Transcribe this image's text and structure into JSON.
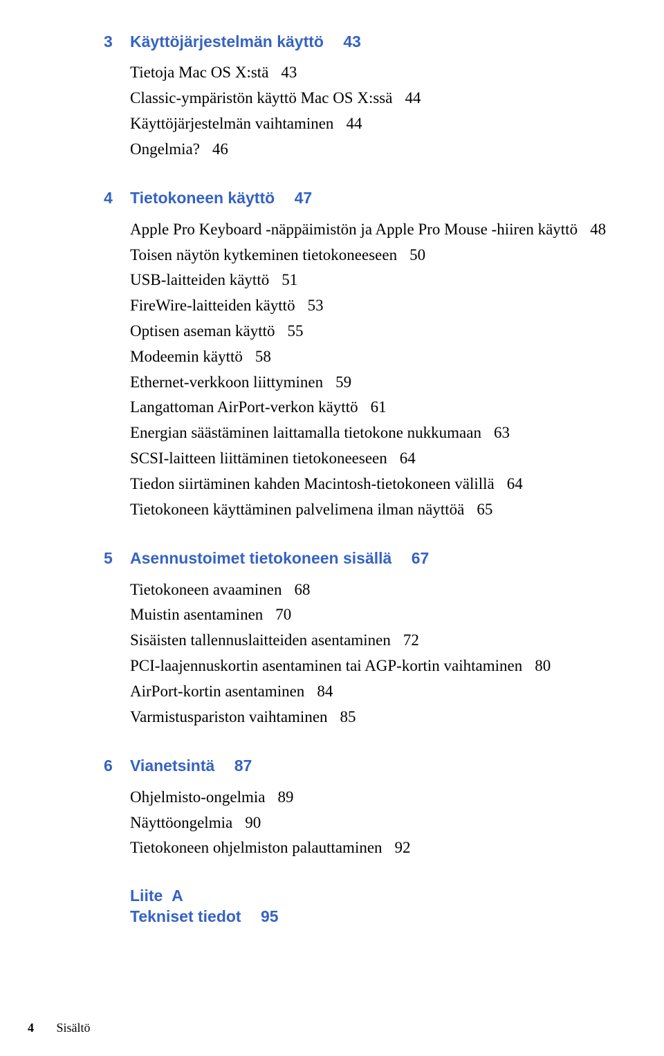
{
  "chapters": [
    {
      "num": "3",
      "title": "Käyttöjärjestelmän käyttö",
      "page": "43",
      "entries": [
        {
          "t": "Tietoja Mac OS X:stä",
          "p": "43"
        },
        {
          "t": "Classic-ympäristön käyttö Mac OS  X:ssä",
          "p": "44"
        },
        {
          "t": "Käyttöjärjestelmän vaihtaminen",
          "p": "44"
        },
        {
          "t": "Ongelmia?",
          "p": "46"
        }
      ]
    },
    {
      "num": "4",
      "title": "Tietokoneen käyttö",
      "page": "47",
      "entries": [
        {
          "t": "Apple Pro Keyboard -näppäimistön ja Apple Pro Mouse -hiiren käyttö",
          "p": "48"
        },
        {
          "t": "Toisen näytön kytkeminen tietokoneeseen",
          "p": "50"
        },
        {
          "t": "USB-laitteiden käyttö",
          "p": "51"
        },
        {
          "t": "FireWire-laitteiden käyttö",
          "p": "53"
        },
        {
          "t": "Optisen aseman käyttö",
          "p": "55"
        },
        {
          "t": "Modeemin käyttö",
          "p": "58"
        },
        {
          "t": "Ethernet-verkkoon liittyminen",
          "p": "59"
        },
        {
          "t": "Langattoman AirPort-verkon käyttö",
          "p": "61"
        },
        {
          "t": "Energian säästäminen laittamalla tietokone nukkumaan",
          "p": "63"
        },
        {
          "t": "SCSI-laitteen liittäminen tietokoneeseen",
          "p": "64"
        },
        {
          "t": "Tiedon siirtäminen kahden Macintosh-tietokoneen välillä",
          "p": "64"
        },
        {
          "t": "Tietokoneen käyttäminen palvelimena ilman näyttöä",
          "p": "65"
        }
      ]
    },
    {
      "num": "5",
      "title": "Asennustoimet tietokoneen sisällä",
      "page": "67",
      "entries": [
        {
          "t": "Tietokoneen avaaminen",
          "p": "68"
        },
        {
          "t": "Muistin asentaminen",
          "p": "70"
        },
        {
          "t": "Sisäisten tallennuslaitteiden asentaminen",
          "p": "72"
        },
        {
          "t": "PCI-laajennuskortin asentaminen tai AGP-kortin vaihtaminen",
          "p": "80"
        },
        {
          "t": "AirPort-kortin asentaminen",
          "p": "84"
        },
        {
          "t": "Varmistuspariston vaihtaminen",
          "p": "85"
        }
      ]
    },
    {
      "num": "6",
      "title": "Vianetsintä",
      "page": "87",
      "entries": [
        {
          "t": "Ohjelmisto-ongelmia",
          "p": "89"
        },
        {
          "t": "Näyttöongelmia",
          "p": "90"
        },
        {
          "t": "Tietokoneen ohjelmiston palauttaminen",
          "p": "92"
        }
      ]
    }
  ],
  "appendix": {
    "label": "Liite",
    "letter": "A",
    "title": "Tekniset tiedot",
    "page": "95"
  },
  "footer": {
    "page_num": "4",
    "section": "Sisältö"
  }
}
